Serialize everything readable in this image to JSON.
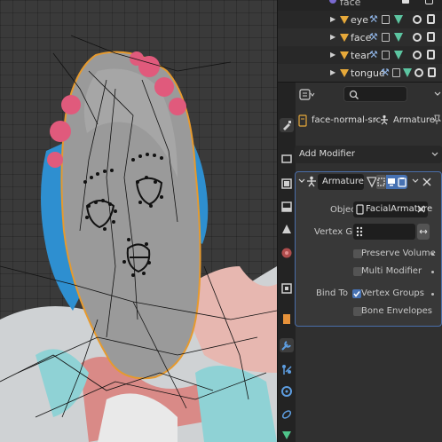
{
  "outliner": {
    "rows": [
      {
        "name": "face",
        "type": "armature-data"
      },
      {
        "name": "eye",
        "type": "mesh"
      },
      {
        "name": "face",
        "type": "mesh"
      },
      {
        "name": "tear",
        "type": "mesh"
      },
      {
        "name": "tongue",
        "type": "mesh"
      }
    ]
  },
  "properties": {
    "search_placeholder": "",
    "breadcrumb": {
      "object": "face-normal-src",
      "modifier": "Armature"
    },
    "add_modifier_label": "Add Modifier",
    "modifier": {
      "name": "Armature",
      "object_label": "Object",
      "object_value": "FacialArmature",
      "vertex_group_label": "Vertex Group",
      "vertex_group_value": "",
      "preserve_volume_label": "Preserve Volume",
      "preserve_volume": false,
      "multi_modifier_label": "Multi Modifier",
      "multi_modifier": false,
      "bind_to_label": "Bind To",
      "vertex_groups_label": "Vertex Groups",
      "vertex_groups": true,
      "bone_envelopes_label": "Bone Envelopes",
      "bone_envelopes": false
    }
  },
  "colors": {
    "accent": "#4772b3",
    "mesh_icon": "#e7a93a",
    "selection_outline": "#e69a2e"
  }
}
